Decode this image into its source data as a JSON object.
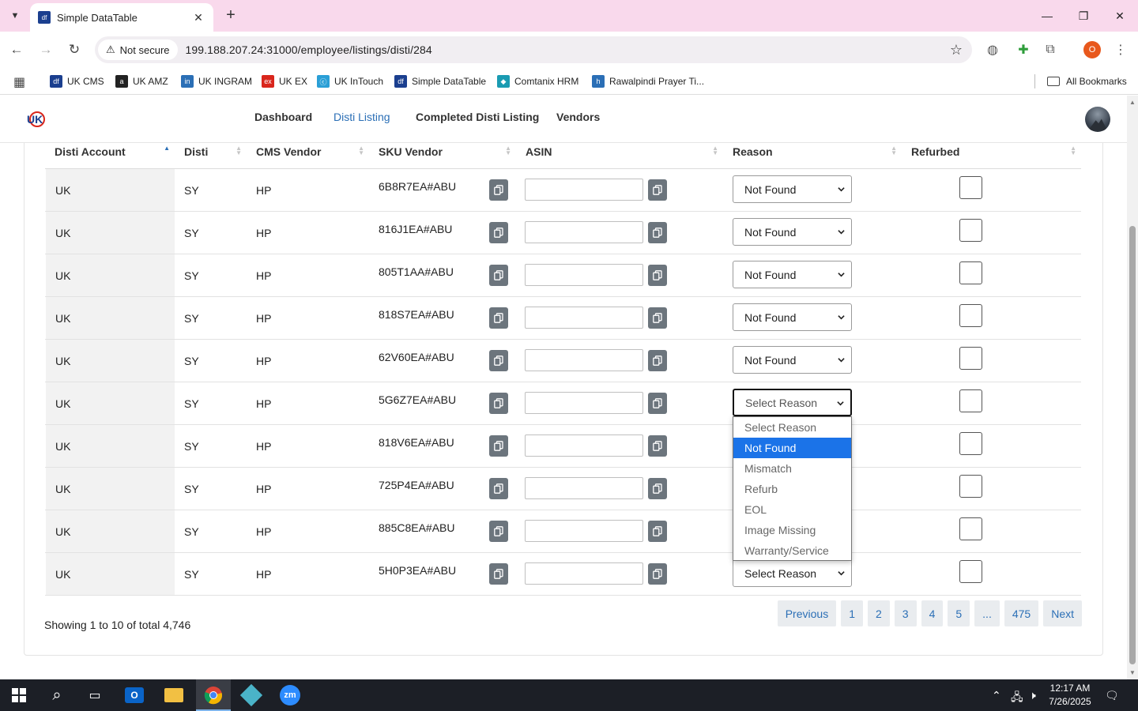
{
  "browser": {
    "tab_title": "Simple DataTable",
    "tab_favicon": "df",
    "security_label": "Not secure",
    "url": "199.188.207.24:31000/employee/listings/disti/284",
    "profile_initial": "O",
    "bookmarks": [
      {
        "label": "UK CMS",
        "icon": "df",
        "color": "#1b3f8f"
      },
      {
        "label": "UK AMZ",
        "icon": "a",
        "color": "#222222"
      },
      {
        "label": "UK INGRAM",
        "icon": "in",
        "color": "#2b6fb6"
      },
      {
        "label": "UK EX",
        "icon": "ex",
        "color": "#d9261c"
      },
      {
        "label": "UK InTouch",
        "icon": "ⓒ",
        "color": "#2a9fd6"
      },
      {
        "label": "Simple DataTable",
        "icon": "df",
        "color": "#1b3f8f"
      },
      {
        "label": "Comtanix HRM",
        "icon": "◆",
        "color": "#1a9bb2"
      },
      {
        "label": "Rawalpindi Prayer Ti...",
        "icon": "h",
        "color": "#2b6fb6"
      }
    ],
    "all_bookmarks": "All Bookmarks"
  },
  "nav": {
    "links": [
      "Dashboard",
      "Disti Listing",
      "Completed Disti Listing",
      "Vendors"
    ],
    "active": "Disti Listing"
  },
  "table": {
    "headers": [
      "Disti Account",
      "Disti",
      "CMS Vendor",
      "SKU Vendor",
      "ASIN",
      "Reason",
      "Refurbed"
    ],
    "sorted_column": "Disti Account",
    "rows": [
      {
        "account": "UK",
        "disti": "SY",
        "vendor": "HP",
        "sku": "6B8R7EA#ABU",
        "asin": "",
        "reason": "Not Found",
        "refurbed": false
      },
      {
        "account": "UK",
        "disti": "SY",
        "vendor": "HP",
        "sku": "816J1EA#ABU",
        "asin": "",
        "reason": "Not Found",
        "refurbed": false
      },
      {
        "account": "UK",
        "disti": "SY",
        "vendor": "HP",
        "sku": "805T1AA#ABU",
        "asin": "",
        "reason": "Not Found",
        "refurbed": false
      },
      {
        "account": "UK",
        "disti": "SY",
        "vendor": "HP",
        "sku": "818S7EA#ABU",
        "asin": "",
        "reason": "Not Found",
        "refurbed": false
      },
      {
        "account": "UK",
        "disti": "SY",
        "vendor": "HP",
        "sku": "62V60EA#ABU",
        "asin": "",
        "reason": "Not Found",
        "refurbed": false
      },
      {
        "account": "UK",
        "disti": "SY",
        "vendor": "HP",
        "sku": "5G6Z7EA#ABU",
        "asin": "",
        "reason": "Select Reason",
        "refurbed": false
      },
      {
        "account": "UK",
        "disti": "SY",
        "vendor": "HP",
        "sku": "818V6EA#ABU",
        "asin": "",
        "reason": "",
        "refurbed": false
      },
      {
        "account": "UK",
        "disti": "SY",
        "vendor": "HP",
        "sku": "725P4EA#ABU",
        "asin": "",
        "reason": "",
        "refurbed": false
      },
      {
        "account": "UK",
        "disti": "SY",
        "vendor": "HP",
        "sku": "885C8EA#ABU",
        "asin": "",
        "reason": "",
        "refurbed": false
      },
      {
        "account": "UK",
        "disti": "SY",
        "vendor": "HP",
        "sku": "5H0P3EA#ABU",
        "asin": "",
        "reason": "Select Reason",
        "refurbed": false
      }
    ]
  },
  "dropdown": {
    "options": [
      "Select Reason",
      "Not Found",
      "Mismatch",
      "Refurb",
      "EOL",
      "Image Missing",
      "Warranty/Service"
    ],
    "highlighted": "Not Found"
  },
  "footer": {
    "showing": "Showing 1 to 10 of total 4,746",
    "pages": [
      "Previous",
      "1",
      "2",
      "3",
      "4",
      "5",
      "...",
      "475",
      "Next"
    ]
  },
  "taskbar": {
    "time": "12:17 AM",
    "date": "7/26/2025"
  },
  "colors": {
    "accent": "#2b6fb6",
    "tab_strip": "#f9d9ec",
    "copy_button": "#6c757d",
    "option_highlight": "#1b73e8"
  }
}
